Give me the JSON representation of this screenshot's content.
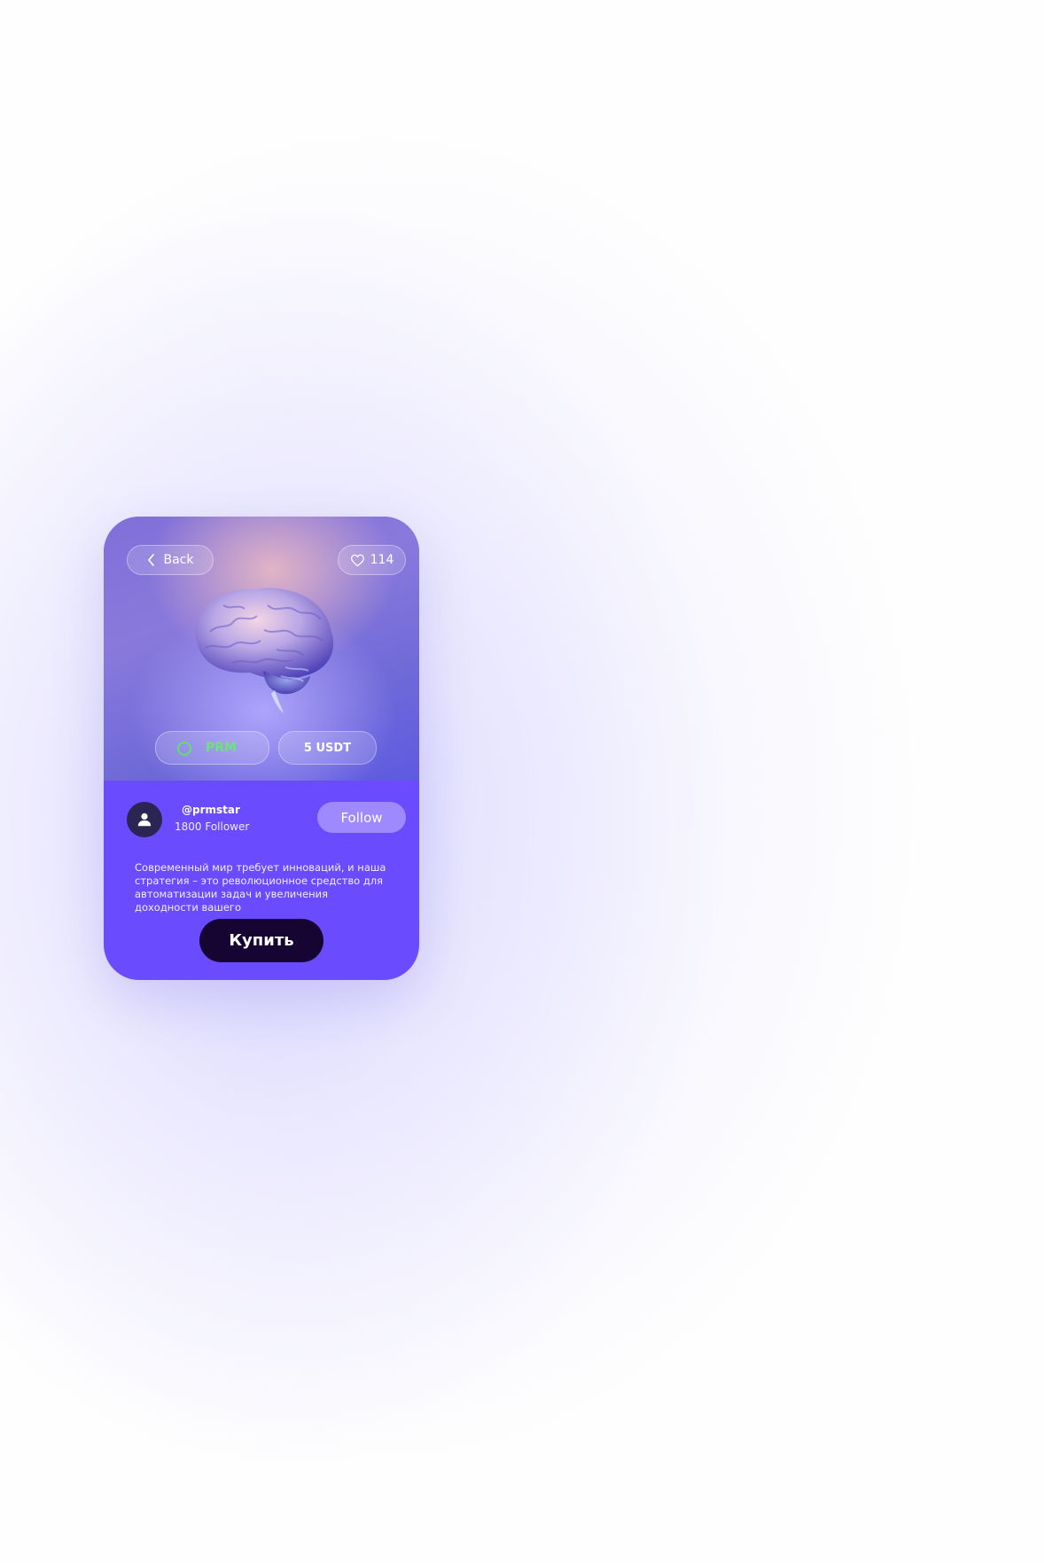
{
  "header": {
    "back_label": "Back",
    "likes_count": "114"
  },
  "product": {
    "token_label": "PRM",
    "price_label": "5 USDT",
    "description": "Современный мир требует инноваций, и наша стратегия – это революционное средство для автоматизации задач и увеличения доходности вашего",
    "buy_label": "Купить"
  },
  "author": {
    "handle": "@prmstar",
    "followers": "1800 Follower",
    "follow_label": "Follow"
  },
  "icons": {
    "back": "chevron-left-icon",
    "like": "heart-icon",
    "token": "ring-icon",
    "avatar": "user-icon"
  },
  "colors": {
    "card_bottom": "#6a4bfe",
    "buy_button": "#160433",
    "follow_button": "#9f89ff",
    "token_accent": "#5fe06c"
  }
}
